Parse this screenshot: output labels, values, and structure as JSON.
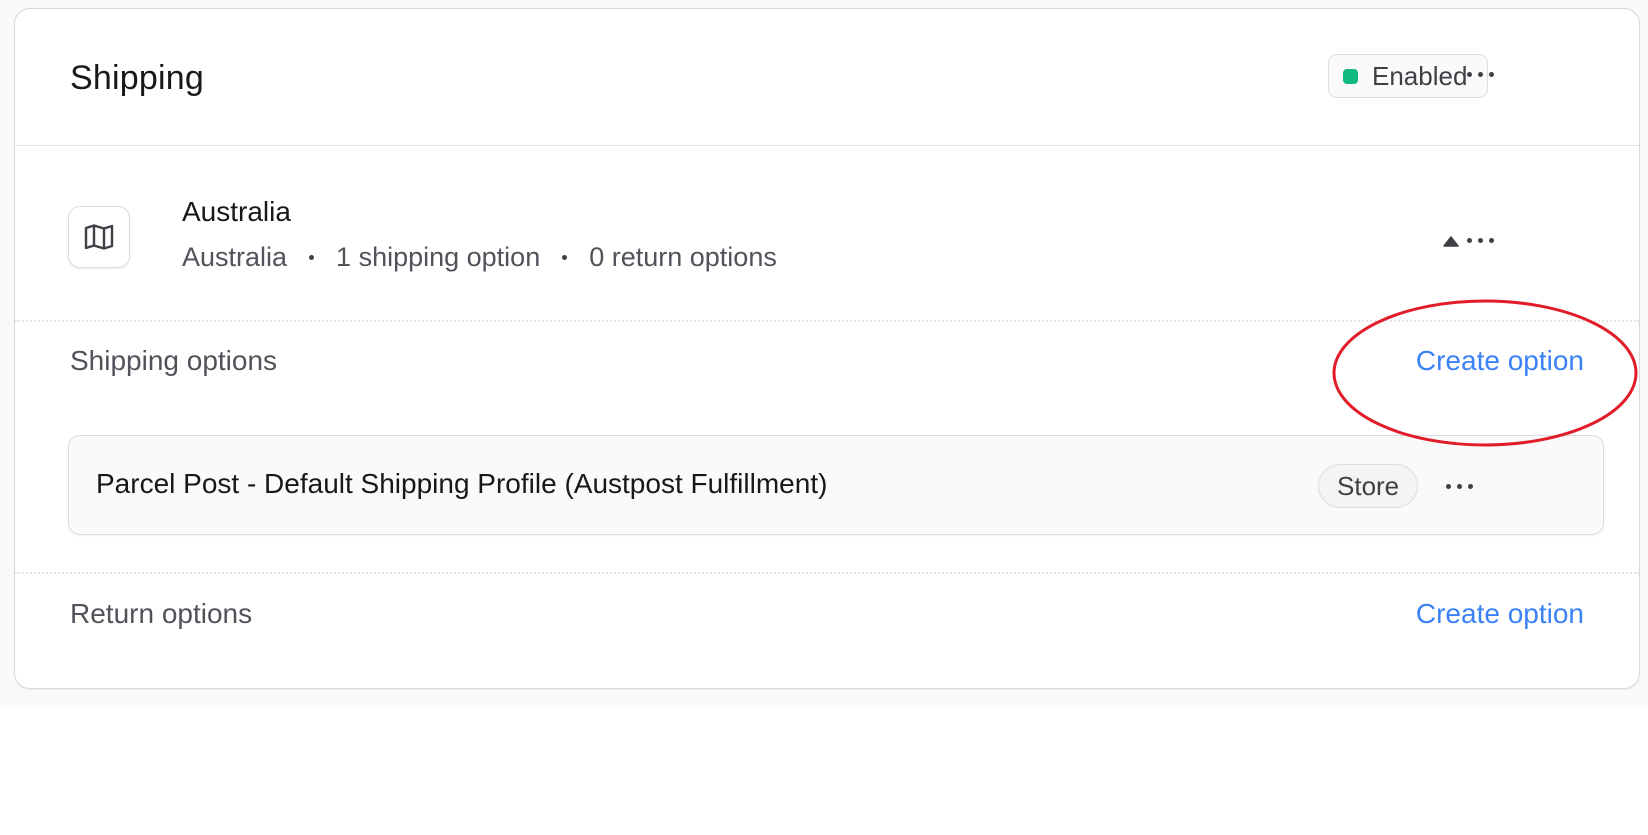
{
  "header": {
    "title": "Shipping",
    "status_label": "Enabled",
    "status_color": "#10b981",
    "menu_icon": "more-horizontal-icon"
  },
  "region": {
    "name": "Australia",
    "icon": "map-icon",
    "meta": [
      "Australia",
      "1 shipping option",
      "0 return options"
    ],
    "collapse_icon": "triangle-up-icon",
    "menu_icon": "more-horizontal-icon"
  },
  "shipping_options": {
    "label": "Shipping options",
    "create_label": "Create option",
    "items": [
      {
        "name": "Parcel Post - Default Shipping Profile (Austpost Fulfillment)",
        "badge": "Store",
        "menu_icon": "more-horizontal-icon"
      }
    ]
  },
  "return_options": {
    "label": "Return options",
    "create_label": "Create option"
  },
  "colors": {
    "link": "#3b82f6",
    "annotation": "#e11d2a"
  }
}
